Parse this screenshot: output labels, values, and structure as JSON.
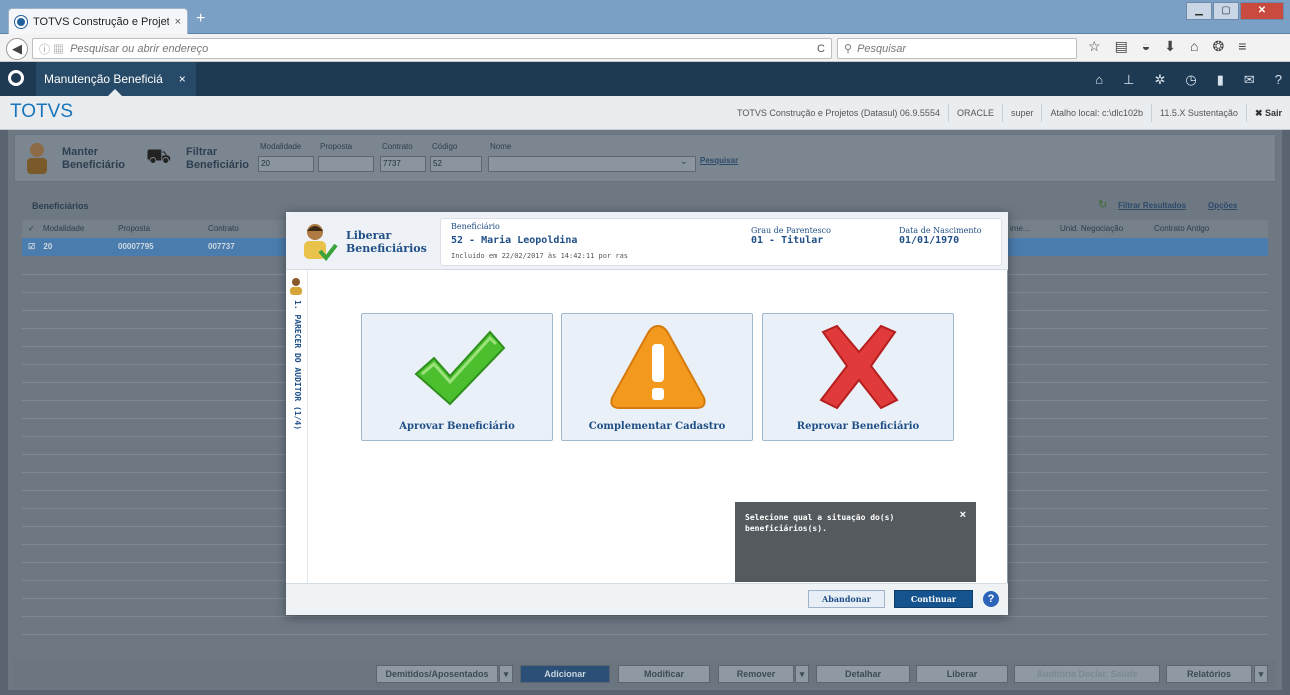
{
  "browser": {
    "tab_title": "TOTVS Construção e Projet...",
    "tab_close": "×",
    "new_tab": "+",
    "address_placeholder": "Pesquisar ou abrir endereço",
    "search_placeholder": "Pesquisar",
    "reload": "C"
  },
  "app": {
    "tab_label": "Manutenção Beneficiá",
    "tab_close": "×",
    "brand": "TOTVS",
    "info": [
      "TOTVS Construção e Projetos (Datasul) 06.9.5554",
      "ORACLE",
      "super",
      "Atalho local: c:\\dlc102b",
      "11.5.X Sustentação",
      "✖ Sair"
    ]
  },
  "background": {
    "manter": [
      "Manter",
      "Beneficiário"
    ],
    "filtrar": [
      "Filtrar",
      "Beneficiário"
    ],
    "field_labels": [
      "Modalidade",
      "Proposta",
      "Contrato",
      "Código",
      "Nome"
    ],
    "field_values": [
      "20",
      "",
      "7737",
      "52",
      ""
    ],
    "pesquisar": "Pesquisar",
    "grid_title": "Beneficiários",
    "filtrar_resultados": "Filtrar Resultados",
    "opcoes": "Opções",
    "columns": [
      "Modalidade",
      "Proposta",
      "Contrato"
    ],
    "columns_right": [
      "ime...",
      "Unid. Negociação",
      "Contrato Antigo"
    ],
    "row": [
      "20",
      "00007795",
      "007737"
    ],
    "bottom_buttons": [
      "Demitidos/Aposentados",
      "Adicionar",
      "Modificar",
      "Remover",
      "Detalhar",
      "Liberar",
      "Auditoria Declar. Saúde",
      "Relatórios"
    ]
  },
  "dialog": {
    "title_line1": "Liberar",
    "title_line2": "Beneficiários",
    "benef_label": "Beneficiário",
    "benef_value": "52 - Maria Leopoldina",
    "grau_label": "Grau de Parentesco",
    "grau_value": "01 - Titular",
    "nasc_label": "Data de Nascimento",
    "nasc_value": "01/01/1970",
    "included": "Incluído em 22/02/2017 às 14:42:11 por ras",
    "step": "1. PARECER DO AUDITOR (1/4)",
    "cards": [
      "Aprovar Beneficiário",
      "Complementar Cadastro",
      "Reprovar Beneficiário"
    ],
    "abandon": "Abandonar",
    "continue": "Continuar",
    "help": "?",
    "tooltip": "Selecione qual a situação do(s) beneficiários(s).",
    "tooltip_close": "×"
  }
}
